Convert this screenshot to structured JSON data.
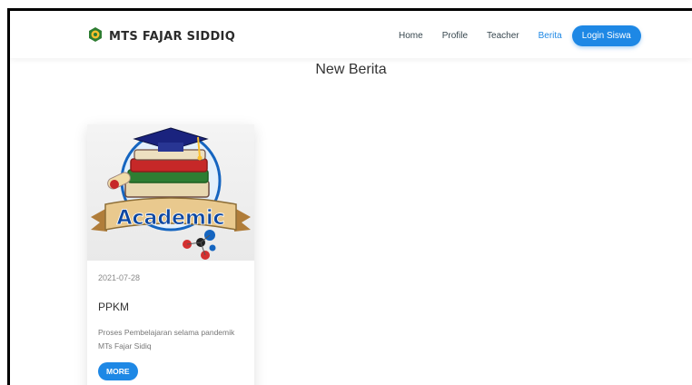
{
  "brand": {
    "name": "MTS FAJAR SIDDIQ",
    "logo_icon": "school-emblem-icon"
  },
  "nav": {
    "items": [
      {
        "label": "Home",
        "active": false
      },
      {
        "label": "Profile",
        "active": false
      },
      {
        "label": "Teacher",
        "active": false
      },
      {
        "label": "Berita",
        "active": true
      }
    ],
    "login_label": "Login Siswa"
  },
  "page": {
    "title": "New Berita"
  },
  "news": [
    {
      "image_icon": "academic-books-graduation-cap-image",
      "image_text": "Academic",
      "date": "2021-07-28",
      "title": "PPKM",
      "description": "Proses Pembelajaran selama pandemik MTs Fajar Sidiq",
      "button_label": "MORE"
    }
  ],
  "colors": {
    "accent": "#1e88e5",
    "brand_green": "#2e7d32"
  }
}
